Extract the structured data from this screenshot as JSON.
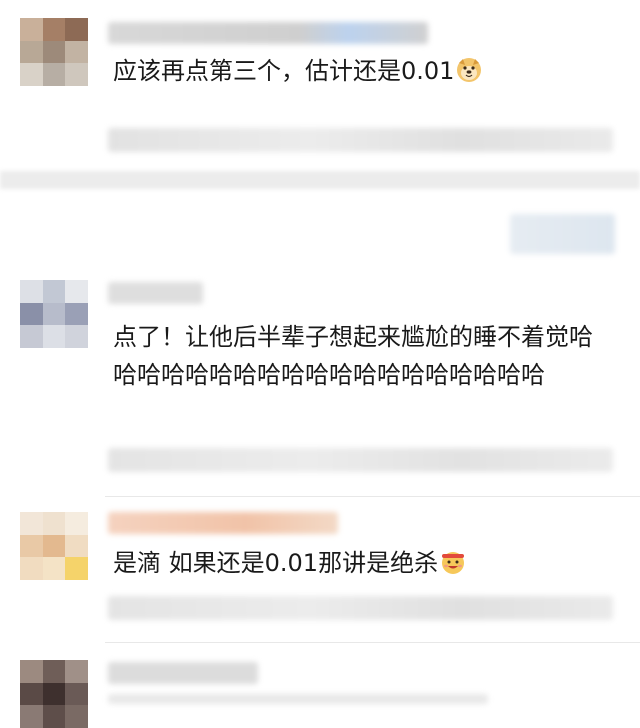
{
  "comments": [
    {
      "text": "应该再点第三个，估计还是0.01",
      "emoji": "doge-emoji"
    },
    {
      "text": "点了！让他后半辈子想起来尴尬的睡不着觉哈哈哈哈哈哈哈哈哈哈哈哈哈哈哈哈哈哈哈",
      "emoji": ""
    },
    {
      "text": "是滴 如果还是0.01那讲是绝杀",
      "emoji": "cheering-emoji"
    }
  ],
  "colors": {
    "text": "#1a1a1a",
    "background": "#ffffff",
    "divider": "#ececec"
  }
}
